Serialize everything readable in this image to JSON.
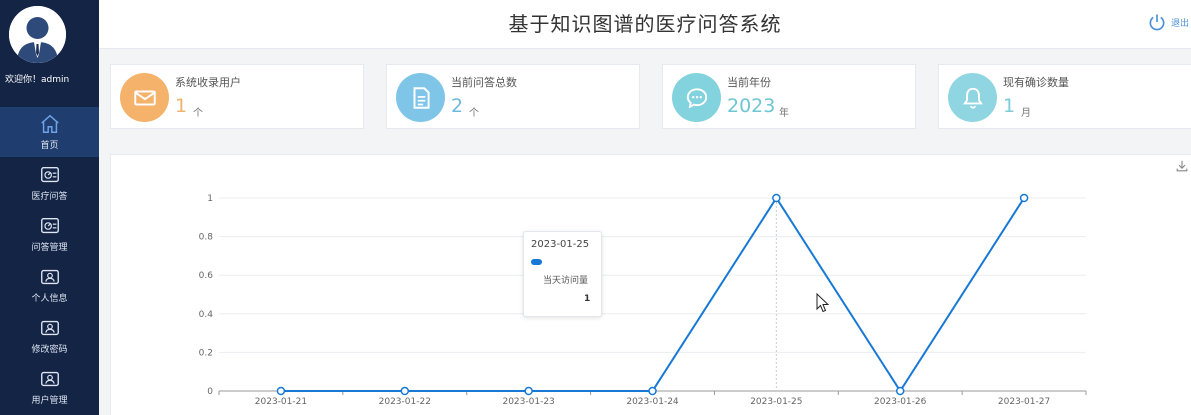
{
  "header": {
    "title": "基于知识图谱的医疗问答系统",
    "logout_label": "退出"
  },
  "sidebar": {
    "welcome": "欢迎你！admin",
    "items": [
      {
        "label": "首页",
        "icon": "home-icon",
        "active": true
      },
      {
        "label": "医疗问答",
        "icon": "dashboard-icon",
        "active": false
      },
      {
        "label": "问答管理",
        "icon": "dashboard-icon",
        "active": false
      },
      {
        "label": "个人信息",
        "icon": "user-card-icon",
        "active": false
      },
      {
        "label": "修改密码",
        "icon": "user-card-icon",
        "active": false
      },
      {
        "label": "用户管理",
        "icon": "user-card-icon",
        "active": false
      }
    ]
  },
  "stats": [
    {
      "label": "系统收录用户",
      "value": "1",
      "unit": "个",
      "icon": "mail-icon",
      "color": "#f5b26b",
      "value_color": "#f0b36e"
    },
    {
      "label": "当前问答总数",
      "value": "2",
      "unit": "个",
      "icon": "document-icon",
      "color": "#7ec5e8",
      "value_color": "#6fb8e0"
    },
    {
      "label": "当前年份",
      "value": "2023",
      "unit": "年",
      "icon": "chat-icon",
      "color": "#82d3dd",
      "value_color": "#6fc6d3"
    },
    {
      "label": "现有确诊数量",
      "value": "1",
      "unit": "月",
      "icon": "bell-icon",
      "color": "#8fd6e2",
      "value_color": "#7ccbd7"
    }
  ],
  "chart_data": {
    "type": "line",
    "x": [
      "2023-01-21",
      "2023-01-22",
      "2023-01-23",
      "2023-01-24",
      "2023-01-25",
      "2023-01-26",
      "2023-01-27"
    ],
    "series": [
      {
        "name": "当天访问量",
        "values": [
          0,
          0,
          0,
          0,
          1,
          0,
          1
        ]
      }
    ],
    "yticks": [
      "0",
      "0.2",
      "0.4",
      "0.6",
      "0.8",
      "1"
    ],
    "ylim": [
      0,
      1
    ],
    "grid": true,
    "color": "#1778d6"
  },
  "tooltip": {
    "date": "2023-01-25",
    "series_name": "当天访问量",
    "value": "1"
  }
}
